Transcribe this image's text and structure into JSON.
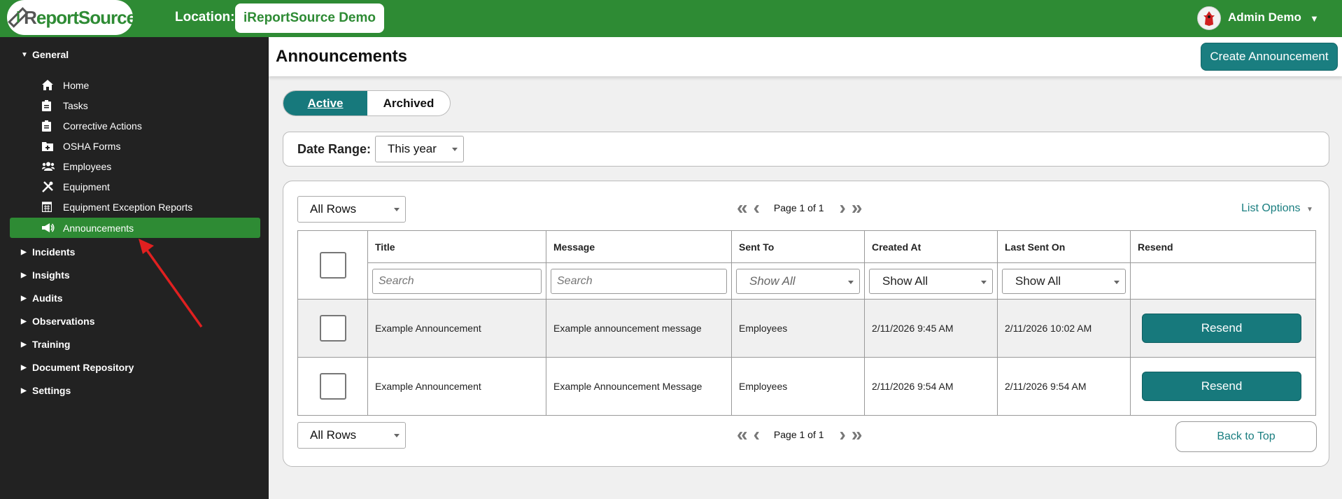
{
  "topbar": {
    "logo_text": "iReportSource",
    "location_label": "Location:",
    "location_value": "iReportSource Demo",
    "user_name": "Admin Demo"
  },
  "sidebar": {
    "general": "General",
    "items": [
      {
        "label": "Home",
        "icon": "home-icon"
      },
      {
        "label": "Tasks",
        "icon": "clipboard-icon"
      },
      {
        "label": "Corrective Actions",
        "icon": "clipboard-icon"
      },
      {
        "label": "OSHA Forms",
        "icon": "medical-folder-icon"
      },
      {
        "label": "Employees",
        "icon": "users-icon"
      },
      {
        "label": "Equipment",
        "icon": "tools-icon"
      },
      {
        "label": "Equipment Exception Reports",
        "icon": "calendar-grid-icon"
      },
      {
        "label": "Announcements",
        "icon": "megaphone-icon"
      }
    ],
    "sections": [
      "Incidents",
      "Insights",
      "Audits",
      "Observations",
      "Training",
      "Document Repository",
      "Settings"
    ]
  },
  "header": {
    "title": "Announcements",
    "create_button": "Create Announcement"
  },
  "tabs": {
    "active": "Active",
    "archived": "Archived"
  },
  "date_range": {
    "label": "Date Range:",
    "value": "This year"
  },
  "table_controls": {
    "rows_select": "All Rows",
    "page_label": "Page 1 of 1",
    "list_options": "List Options",
    "back_to_top": "Back to Top"
  },
  "table": {
    "columns": [
      "Title",
      "Message",
      "Sent To",
      "Created At",
      "Last Sent On",
      "Resend"
    ],
    "filters": {
      "title_placeholder": "Search",
      "message_placeholder": "Search",
      "sent_to": "Show All",
      "created_at": "Show All",
      "last_sent_on": "Show All"
    },
    "rows": [
      {
        "title": "Example Announcement",
        "message": "Example announcement message",
        "sent_to": "Employees",
        "created_at": "2/11/2026 9:45 AM",
        "last_sent_on": "2/11/2026 10:02 AM",
        "resend": "Resend"
      },
      {
        "title": "Example Announcement",
        "message": "Example Announcement Message",
        "sent_to": "Employees",
        "created_at": "2/11/2026 9:54 AM",
        "last_sent_on": "2/11/2026 9:54 AM",
        "resend": "Resend"
      }
    ]
  },
  "colors": {
    "brand_green": "#2e8b34",
    "teal": "#17797c",
    "sidebar_bg": "#222222",
    "annotation_arrow": "#e02020"
  }
}
